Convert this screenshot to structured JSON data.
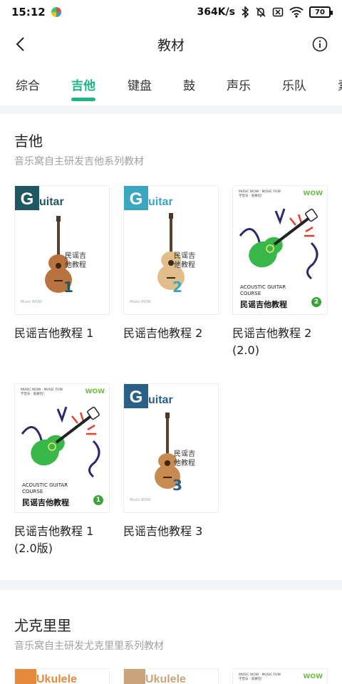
{
  "status": {
    "time": "15:12",
    "net_speed": "364K/s",
    "battery": "70"
  },
  "header": {
    "title": "教材"
  },
  "tabs": [
    "综合",
    "吉他",
    "键盘",
    "鼓",
    "声乐",
    "乐队",
    "素"
  ],
  "colors": {
    "accent": "#1cb585"
  },
  "section1": {
    "title": "吉他",
    "subtitle": "音乐窝自主研发吉他系列教材",
    "books": [
      {
        "label": "民谣吉他教程 1"
      },
      {
        "label": "民谣吉他教程 2"
      },
      {
        "label": "民谣吉他教程 2 (2.0)"
      },
      {
        "label": "民谣吉他教程 1 (2.0版)"
      },
      {
        "label": "民谣吉他教程 3"
      }
    ]
  },
  "covers": {
    "guitar_word": "uitar",
    "guitar_letter": "G",
    "cn_lines": "民谣吉他教程",
    "num1": "1",
    "num2": "2",
    "num3": "3",
    "ac_top": "MUSIC WOW · MUSIC FUN!\n学音乐 · 就要玩!",
    "ac_logo": "WOW",
    "ac_en": "ACOUSTIC GUITAR\nCOURSE",
    "ac_cn": "民谣吉他教程",
    "badge2": "2",
    "badge1": "1",
    "foot": "Music WOW"
  },
  "section2": {
    "title": "尤克里里",
    "subtitle": "音乐窝自主研发尤克里里系列教材",
    "cover_word": "Ukulele"
  }
}
